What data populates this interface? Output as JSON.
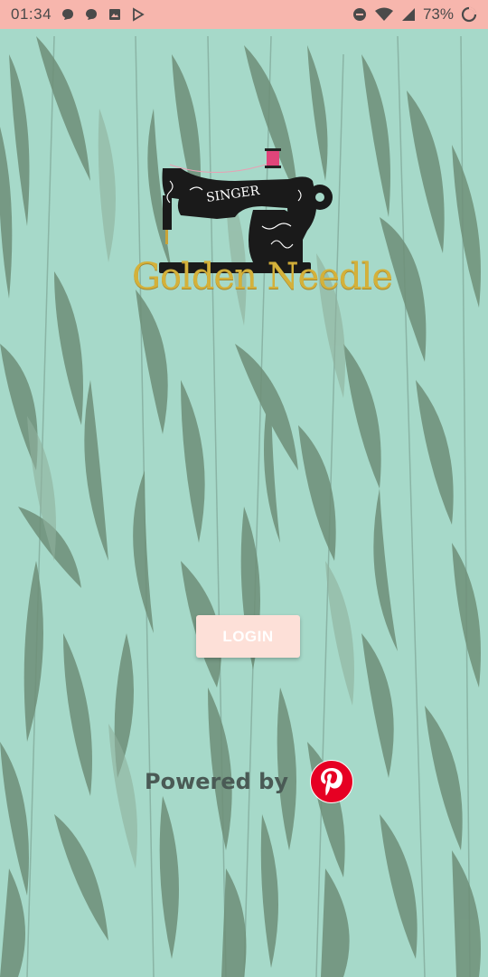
{
  "status_bar": {
    "time": "01:34",
    "battery_percent": "73%",
    "icons_left": [
      "chat-bubble-icon",
      "chat-bubble-icon",
      "image-icon",
      "play-store-icon"
    ],
    "icons_right": [
      "do-not-disturb-icon",
      "wifi-icon",
      "signal-icon",
      "battery-icon"
    ]
  },
  "logo": {
    "brand_on_machine": "SINGER",
    "title": "Golden Needle"
  },
  "login_button": {
    "label": "LOGIN"
  },
  "footer": {
    "powered_by": "Powered by",
    "partner_icon": "pinterest-icon"
  },
  "colors": {
    "background": "#a6d9c9",
    "status_bar": "#f7b6ad",
    "login_button": "#fde0d8",
    "pinterest_red": "#e60023",
    "gold": "#d4b13a"
  }
}
